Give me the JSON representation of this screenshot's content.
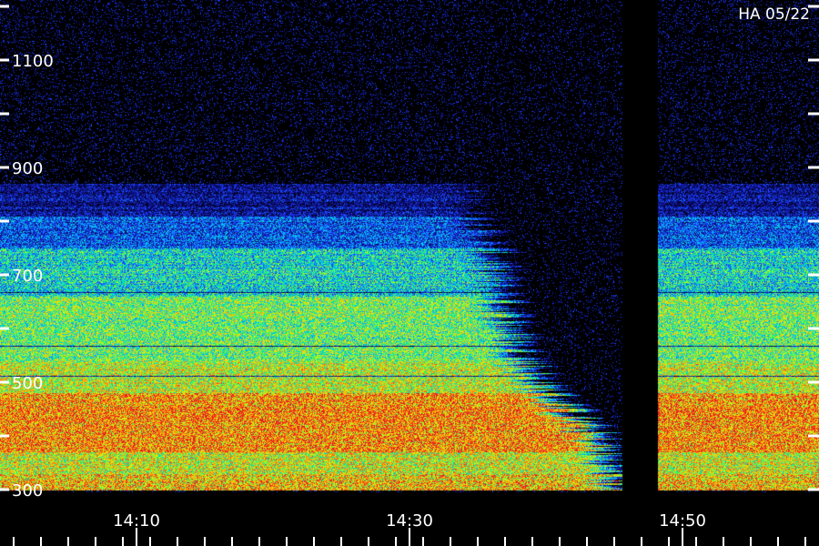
{
  "station_label": "HA 05/22",
  "chart_data": {
    "type": "heatmap",
    "title": "",
    "xlabel": "",
    "ylabel": "",
    "y_ticks": [
      300,
      500,
      700,
      900,
      1100
    ],
    "y_minor_ticks": [
      400,
      600,
      800,
      1000,
      1200
    ],
    "ylim": [
      300,
      1180
    ],
    "x_ticks": [
      "14:10",
      "14:30",
      "14:50"
    ],
    "xlim": [
      "14:00",
      "14:59"
    ],
    "x_minor_tick_minutes": 2,
    "data_gap": {
      "start": "14:46",
      "end": "14:48"
    },
    "emission_bands": [
      {
        "from": 300,
        "to": 330,
        "level": 0.78
      },
      {
        "from": 330,
        "to": 370,
        "level": 0.68
      },
      {
        "from": 370,
        "to": 480,
        "level": 0.86
      },
      {
        "from": 480,
        "to": 540,
        "level": 0.66
      },
      {
        "from": 540,
        "to": 660,
        "level": 0.56
      },
      {
        "from": 660,
        "to": 750,
        "level": 0.42
      },
      {
        "from": 750,
        "to": 810,
        "level": 0.26
      },
      {
        "from": 810,
        "to": 870,
        "level": 0.14
      },
      {
        "from": 870,
        "to": 1180,
        "level": 0.02
      }
    ],
    "dark_lines": [
      512,
      668,
      568
    ],
    "fade_boundary": [
      {
        "mhz": 300,
        "time": "14:44"
      },
      {
        "mhz": 400,
        "time": "14:42"
      },
      {
        "mhz": 500,
        "time": "14:38"
      },
      {
        "mhz": 600,
        "time": "14:36"
      },
      {
        "mhz": 700,
        "time": "14:35"
      },
      {
        "mhz": 800,
        "time": "14:34"
      },
      {
        "mhz": 900,
        "time": "14:33"
      }
    ],
    "colormap": [
      "#000000",
      "#0a0a7a",
      "#1e3cff",
      "#00c8ff",
      "#14f078",
      "#b4ff1e",
      "#ffd200",
      "#ff7814",
      "#e61e1e"
    ]
  }
}
